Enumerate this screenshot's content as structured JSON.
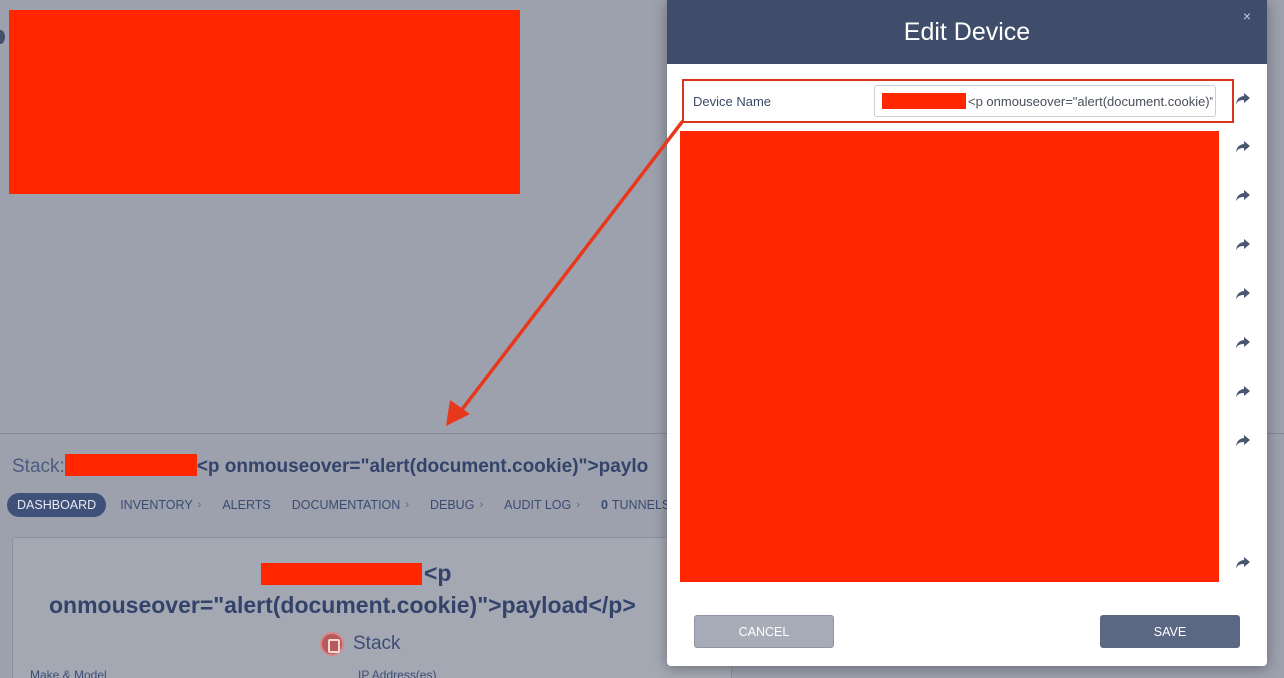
{
  "background": {
    "stack_label": "Stack:",
    "stack_payload": "<p onmouseover=\"alert(document.cookie)\">paylo",
    "nav": [
      {
        "label": "DASHBOARD",
        "active": true
      },
      {
        "label": "INVENTORY",
        "chevron": "›"
      },
      {
        "label": "ALERTS"
      },
      {
        "label": "DOCUMENTATION",
        "chevron": "›"
      },
      {
        "label": "DEBUG",
        "chevron": "›"
      },
      {
        "label": "AUDIT LOG",
        "chevron": "›"
      },
      {
        "count": "0",
        "label": "TUNNELS"
      }
    ],
    "card": {
      "heading_line1": "<p",
      "heading_line2": "onmouseover=\"alert(document.cookie)\">payload</p>",
      "type_label": "Stack",
      "bottom_left": "Make & Model",
      "bottom_right": "IP Address(es)"
    }
  },
  "modal": {
    "title": "Edit Device",
    "close_icon": "×",
    "device_name_label": "Device Name",
    "device_name_value": "<p onmouseover=\"alert(document.cookie)\">payload</p>",
    "cancel_label": "CANCEL",
    "save_label": "SAVE"
  },
  "colors": {
    "redaction": "#ff2600",
    "modal_header": "#3f4d6b",
    "annotation": "#e8381c"
  }
}
